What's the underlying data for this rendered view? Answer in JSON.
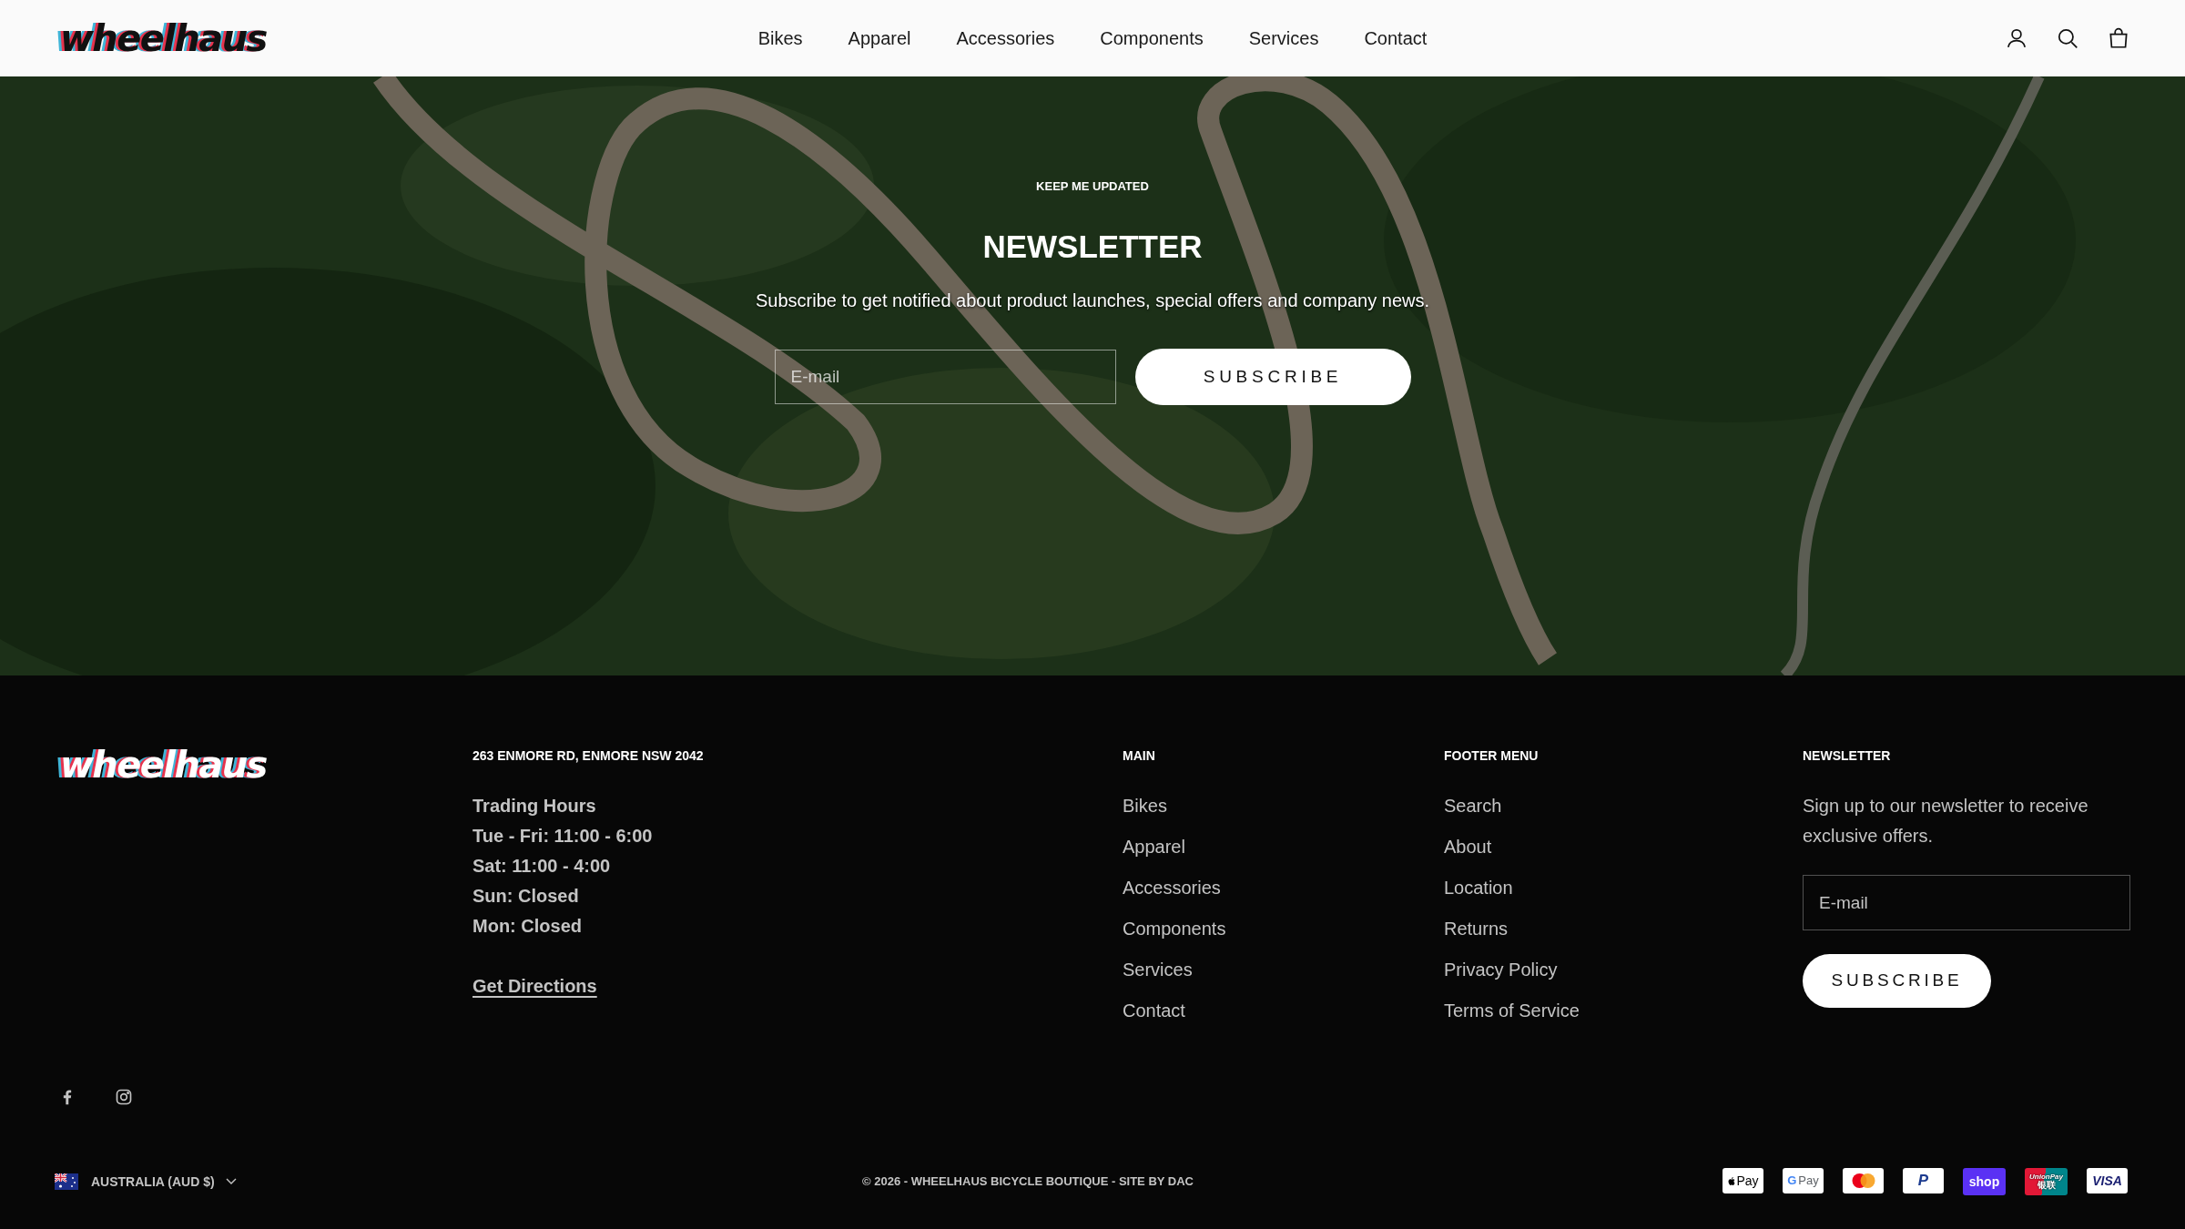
{
  "header": {
    "logo": "wheelhaus",
    "nav": [
      {
        "label": "Bikes"
      },
      {
        "label": "Apparel"
      },
      {
        "label": "Accessories"
      },
      {
        "label": "Components"
      },
      {
        "label": "Services"
      },
      {
        "label": "Contact"
      }
    ],
    "actions": [
      {
        "kind": "account"
      },
      {
        "kind": "search"
      },
      {
        "kind": "cart"
      }
    ]
  },
  "hero": {
    "kind": "picture",
    "eyebrow": "KEEP ME UPDATED",
    "title": "NEWSLETTER",
    "text": "Subscribe to get notified about product launches, special offers and company news.",
    "email": {
      "placeholder": "E-mail"
    },
    "button": "SUBSCRIBE"
  },
  "footer": {
    "logo": "wheelhaus",
    "address": "263 ENMORE RD, ENMORE NSW 2042",
    "hours": [
      "Trading Hours",
      "Tue - Fri: 11:00 - 6:00",
      "Sat: 11:00 - 4:00",
      "Sun: Closed",
      "Mon: Closed"
    ],
    "directions": "Get Directions",
    "menus": [
      {
        "title": "MAIN",
        "items": [
          "Bikes",
          "Apparel",
          "Accessories",
          "Components",
          "Services",
          "Contact"
        ]
      },
      {
        "title": "FOOTER MENU",
        "items": [
          "Search",
          "About",
          "Location",
          "Returns",
          "Privacy Policy",
          "Terms of Service"
        ]
      }
    ],
    "newsletter": {
      "title": "NEWSLETTER",
      "text": "Sign up to our newsletter to receive exclusive offers.",
      "email": {
        "placeholder": "E-mail"
      },
      "button": "SUBSCRIBE"
    },
    "social": [
      {
        "kind": "facebook"
      },
      {
        "kind": "instagram"
      }
    ],
    "country": "AUSTRALIA (AUD $)",
    "copyright": "© 2026 - WHEELHAUS BICYCLE BOUTIQUE - SITE BY DAC",
    "payments": [
      {
        "kind": "applepay",
        "label": "Pay"
      },
      {
        "kind": "googlepay",
        "mark": "G",
        "label": "Pay"
      },
      {
        "kind": "mastercard"
      },
      {
        "kind": "paypal",
        "label": "P"
      },
      {
        "kind": "shop",
        "label": "shop"
      },
      {
        "kind": "unionpay",
        "label": "UnionPay",
        "sub": "银联"
      },
      {
        "kind": "visa",
        "label": "VISA"
      }
    ]
  }
}
